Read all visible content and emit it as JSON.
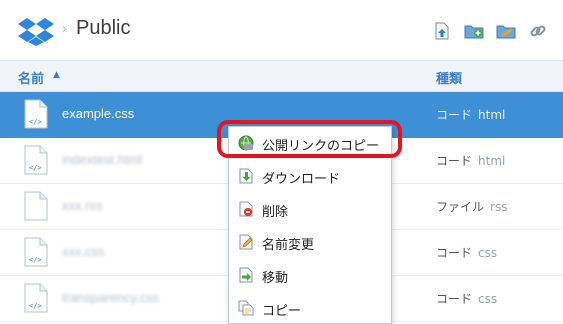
{
  "header": {
    "title": "Public",
    "logo_icon": "dropbox-logo",
    "breadcrumb_separator": "›",
    "toolbar": [
      {
        "icon": "upload-icon"
      },
      {
        "icon": "new-folder-icon"
      },
      {
        "icon": "shared-folder-icon"
      },
      {
        "icon": "link-icon"
      }
    ]
  },
  "columns": {
    "name_label": "名前",
    "sort_glyph": "▲",
    "kind_label": "種類"
  },
  "rows": [
    {
      "name": "example.css",
      "kind": "コード",
      "ext": "html",
      "selected": true,
      "blurred": false
    },
    {
      "name": "indextest.html",
      "kind": "コード",
      "ext": "html",
      "selected": false,
      "blurred": true
    },
    {
      "name": "xxx.rss",
      "kind": "ファイル",
      "ext": "rss",
      "selected": false,
      "blurred": true
    },
    {
      "name": "xxx.css",
      "kind": "コード",
      "ext": "css",
      "selected": false,
      "blurred": true
    },
    {
      "name": "transparency.css",
      "kind": "コード",
      "ext": "css",
      "selected": false,
      "blurred": true
    }
  ],
  "context_menu": {
    "items": [
      {
        "label": "公開リンクのコピー",
        "icon": "public-link-icon"
      },
      {
        "label": "ダウンロード",
        "icon": "download-icon"
      },
      {
        "label": "削除",
        "icon": "delete-icon"
      },
      {
        "label": "名前変更",
        "icon": "rename-icon"
      },
      {
        "label": "移動",
        "icon": "move-icon"
      },
      {
        "label": "コピー",
        "icon": "copy-icon"
      }
    ]
  },
  "colors": {
    "selected_row": "#3d8fd6",
    "header_link": "#3b7fc4",
    "highlight": "#e8141d"
  }
}
